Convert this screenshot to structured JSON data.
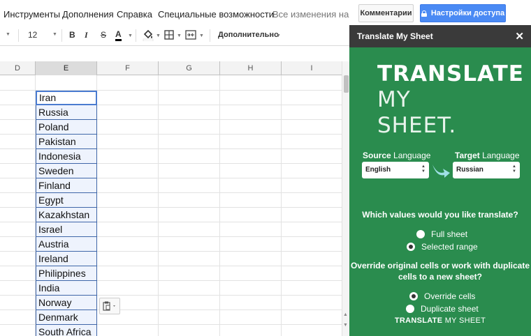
{
  "menubar": {
    "items": [
      "Инструменты",
      "Дополнения",
      "Справка",
      "Специальные возможности"
    ],
    "status": "Все изменения на ...",
    "comments_label": "Комментарии",
    "share_label": "Настройки доступа",
    "share_color": "#4a8af4"
  },
  "toolbar": {
    "font_size": "12",
    "bold": "B",
    "italic": "I",
    "strikethrough": "S",
    "text_color": "A",
    "more_label": "Дополнительно"
  },
  "sheet": {
    "columns": [
      "D",
      "E",
      "F",
      "G",
      "H",
      "I"
    ],
    "selected_column": "E",
    "column_e_values": [
      "Iran",
      "Russia",
      "Poland",
      "Pakistan",
      "Indonesia",
      "Sweden",
      "Finland",
      "Egypt",
      "Kazakhstan",
      "Israel",
      "Austria",
      "Ireland",
      "Philippines",
      "India",
      "Norway",
      "Denmark",
      "South Africa"
    ]
  },
  "sidebar": {
    "title": "Translate My Sheet",
    "logo_line1": "TRANSLATE",
    "logo_line2": "MY",
    "logo_line3": "SHEET.",
    "source_label_bold": "Source",
    "source_label_rest": " Language",
    "target_label_bold": "Target",
    "target_label_rest": " Language",
    "source_value": "English",
    "target_value": "Russian",
    "question1": "Which values would you like translate?",
    "option_full": "Full sheet",
    "option_range": "Selected range",
    "question2_line1": "Override original cells or work with duplicate",
    "question2_line2": "cells to a new sheet?",
    "option_override": "Override cells",
    "option_duplicate": "Duplicate sheet",
    "footer_bold": "TRANSLATE",
    "footer_rest": " MY SHEET",
    "bg_color": "#2a8c4e"
  }
}
